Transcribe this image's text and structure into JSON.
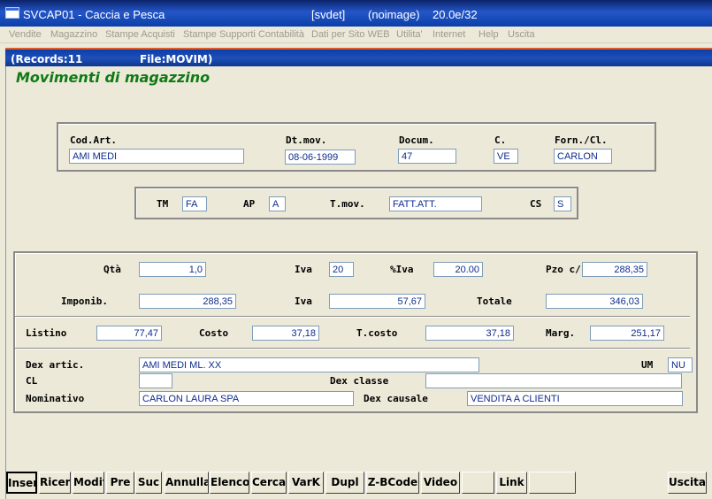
{
  "titlebar": {
    "app": "SVCAP01 - Caccia e Pesca",
    "session": "[svdet]",
    "image": "(noimage)",
    "version": "20.0e/32"
  },
  "menu": [
    "Vendite",
    "Magazzino",
    "Stampe Acquisti",
    "Stampe Supporti Contabilità",
    "Dati per Sito WEB",
    "Utilita'",
    "Internet",
    "Help",
    "Uscita"
  ],
  "status": {
    "records": "(Records:11",
    "file": "File:MOVIM)"
  },
  "form_title": "Movimenti di magazzino",
  "header": {
    "cod_art_label": "Cod.Art.",
    "cod_art": "AMI MEDI",
    "dt_mov_label": "Dt.mov.",
    "dt_mov": "08-06-1999",
    "docum_label": "Docum.",
    "docum": "47",
    "c_label": "C.",
    "c": "VE",
    "forn_label": "Forn./Cl.",
    "forn": "CARLON"
  },
  "movtype": {
    "tm_label": "TM",
    "tm": "FA",
    "ap_label": "AP",
    "ap": "A",
    "tmov_label": "T.mov.",
    "tmov": "FATT.ATT.",
    "cs_label": "CS",
    "cs": "S"
  },
  "detail": {
    "qta_label": "Qtà",
    "qta": "1,0",
    "iva_label": "Iva",
    "iva": "20",
    "piva_label": "%Iva",
    "piva": "20.00",
    "pzo_label": "Pzo c/",
    "pzo": "288,35",
    "imponib_label": "Imponib.",
    "imponib": "288,35",
    "iva2_label": "Iva",
    "iva2": "57,67",
    "totale_label": "Totale",
    "totale": "346,03",
    "listino_label": "Listino",
    "listino": "77,47",
    "costo_label": "Costo",
    "costo": "37,18",
    "tcosto_label": "T.costo",
    "tcosto": "37,18",
    "marg_label": "Marg.",
    "marg": "251,17",
    "dex_artic_label": "Dex artic.",
    "dex_artic": "AMI MEDI  ML. XX",
    "um_label": "UM",
    "um": "NU",
    "cl_label": "CL",
    "cl": "",
    "dex_classe_label": "Dex classe",
    "dex_classe": "",
    "nominativo_label": "Nominativo",
    "nominativo": "CARLON LAURA SPA",
    "dex_causale_label": "Dex causale",
    "dex_causale": "VENDITA A CLIENTI"
  },
  "buttons": [
    "Inser",
    "Ricer",
    "Modif",
    "Pre",
    "Suc",
    "Annulla",
    "Elenco",
    "Cerca",
    "VarK",
    "Dupl",
    "Z-BCode",
    "Video",
    "",
    "Link",
    "",
    "Uscita"
  ]
}
